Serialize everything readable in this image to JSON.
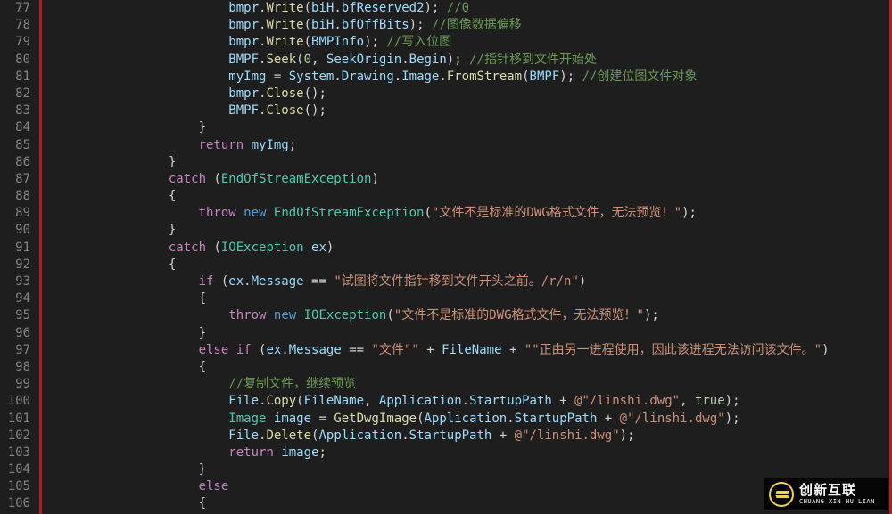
{
  "gutter": {
    "start": 77,
    "end": 106
  },
  "logo": {
    "cn": "创新互联",
    "en": "CHUANG XIN HU LIAN"
  },
  "lines": [
    [
      [
        "",
        24
      ],
      [
        "id",
        "bmpr"
      ],
      [
        "pn",
        "."
      ],
      [
        "fn",
        "Write"
      ],
      [
        "pn",
        "("
      ],
      [
        "id",
        "biH"
      ],
      [
        "pn",
        "."
      ],
      [
        "id",
        "bfReserved2"
      ],
      [
        "pn",
        "); "
      ],
      [
        "cmt",
        "//0"
      ]
    ],
    [
      [
        "",
        24
      ],
      [
        "id",
        "bmpr"
      ],
      [
        "pn",
        "."
      ],
      [
        "fn",
        "Write"
      ],
      [
        "pn",
        "("
      ],
      [
        "id",
        "biH"
      ],
      [
        "pn",
        "."
      ],
      [
        "id",
        "bfOffBits"
      ],
      [
        "pn",
        "); "
      ],
      [
        "cmt",
        "//图像数据偏移"
      ]
    ],
    [
      [
        "",
        24
      ],
      [
        "id",
        "bmpr"
      ],
      [
        "pn",
        "."
      ],
      [
        "fn",
        "Write"
      ],
      [
        "pn",
        "("
      ],
      [
        "id",
        "BMPInfo"
      ],
      [
        "pn",
        "); "
      ],
      [
        "cmt",
        "//写入位图"
      ]
    ],
    [
      [
        "",
        24
      ],
      [
        "id",
        "BMPF"
      ],
      [
        "pn",
        "."
      ],
      [
        "fn",
        "Seek"
      ],
      [
        "pn",
        "("
      ],
      [
        "num",
        "0"
      ],
      [
        "pn",
        ", "
      ],
      [
        "id",
        "SeekOrigin"
      ],
      [
        "pn",
        "."
      ],
      [
        "id",
        "Begin"
      ],
      [
        "pn",
        "); "
      ],
      [
        "cmt",
        "//指针移到文件开始处"
      ]
    ],
    [
      [
        "",
        24
      ],
      [
        "id",
        "myImg"
      ],
      [
        "pn",
        " = "
      ],
      [
        "id",
        "System"
      ],
      [
        "pn",
        "."
      ],
      [
        "id",
        "Drawing"
      ],
      [
        "pn",
        "."
      ],
      [
        "id",
        "Image"
      ],
      [
        "pn",
        "."
      ],
      [
        "fn",
        "FromStream"
      ],
      [
        "pn",
        "("
      ],
      [
        "id",
        "BMPF"
      ],
      [
        "pn",
        "); "
      ],
      [
        "cmt",
        "//创建位图文件对象"
      ]
    ],
    [
      [
        "",
        24
      ],
      [
        "id",
        "bmpr"
      ],
      [
        "pn",
        "."
      ],
      [
        "fn",
        "Close"
      ],
      [
        "pn",
        "();"
      ]
    ],
    [
      [
        "",
        24
      ],
      [
        "id",
        "BMPF"
      ],
      [
        "pn",
        "."
      ],
      [
        "fn",
        "Close"
      ],
      [
        "pn",
        "();"
      ]
    ],
    [
      [
        "",
        20
      ],
      [
        "pn",
        "}"
      ]
    ],
    [
      [
        "",
        20
      ],
      [
        "kw",
        "return"
      ],
      [
        "pn",
        " "
      ],
      [
        "id",
        "myImg"
      ],
      [
        "pn",
        ";"
      ]
    ],
    [
      [
        "",
        16
      ],
      [
        "pn",
        "}"
      ]
    ],
    [
      [
        "",
        16
      ],
      [
        "kw",
        "catch"
      ],
      [
        "pn",
        " ("
      ],
      [
        "type",
        "EndOfStreamException"
      ],
      [
        "pn",
        ")"
      ]
    ],
    [
      [
        "",
        16
      ],
      [
        "pn",
        "{"
      ]
    ],
    [
      [
        "",
        20
      ],
      [
        "kw",
        "throw"
      ],
      [
        "pn",
        " "
      ],
      [
        "blue",
        "new"
      ],
      [
        "pn",
        " "
      ],
      [
        "type",
        "EndOfStreamException"
      ],
      [
        "pn",
        "("
      ],
      [
        "str",
        "\"文件不是标准的DWG格式文件，无法预览！\""
      ],
      [
        "pn",
        ");"
      ]
    ],
    [
      [
        "",
        16
      ],
      [
        "pn",
        "}"
      ]
    ],
    [
      [
        "",
        16
      ],
      [
        "kw",
        "catch"
      ],
      [
        "pn",
        " ("
      ],
      [
        "type",
        "IOException"
      ],
      [
        "pn",
        " "
      ],
      [
        "id",
        "ex"
      ],
      [
        "pn",
        ")"
      ]
    ],
    [
      [
        "",
        16
      ],
      [
        "pn",
        "{"
      ]
    ],
    [
      [
        "",
        20
      ],
      [
        "kw",
        "if"
      ],
      [
        "pn",
        " ("
      ],
      [
        "id",
        "ex"
      ],
      [
        "pn",
        "."
      ],
      [
        "id",
        "Message"
      ],
      [
        "pn",
        " == "
      ],
      [
        "str",
        "\"试图将文件指针移到文件开头之前。/r/n\""
      ],
      [
        "pn",
        ")"
      ]
    ],
    [
      [
        "",
        20
      ],
      [
        "pn",
        "{"
      ]
    ],
    [
      [
        "",
        24
      ],
      [
        "kw",
        "throw"
      ],
      [
        "pn",
        " "
      ],
      [
        "blue",
        "new"
      ],
      [
        "pn",
        " "
      ],
      [
        "type",
        "IOException"
      ],
      [
        "pn",
        "("
      ],
      [
        "str",
        "\"文件不是标准的DWG格式文件，无法预览！\""
      ],
      [
        "pn",
        ");"
      ]
    ],
    [
      [
        "",
        20
      ],
      [
        "pn",
        "}"
      ]
    ],
    [
      [
        "",
        20
      ],
      [
        "kw",
        "else"
      ],
      [
        "pn",
        " "
      ],
      [
        "kw",
        "if"
      ],
      [
        "pn",
        " ("
      ],
      [
        "id",
        "ex"
      ],
      [
        "pn",
        "."
      ],
      [
        "id",
        "Message"
      ],
      [
        "pn",
        " == "
      ],
      [
        "str",
        "\"文件\"\""
      ],
      [
        "pn",
        " + "
      ],
      [
        "id",
        "FileName"
      ],
      [
        "pn",
        " + "
      ],
      [
        "str",
        "\"\"正由另一进程使用，因此该进程无法访问该文件。\""
      ],
      [
        "pn",
        ")"
      ]
    ],
    [
      [
        "",
        20
      ],
      [
        "pn",
        "{"
      ]
    ],
    [
      [
        "",
        24
      ],
      [
        "cmt",
        "//复制文件，继续预览"
      ]
    ],
    [
      [
        "",
        24
      ],
      [
        "id",
        "File"
      ],
      [
        "pn",
        "."
      ],
      [
        "fn",
        "Copy"
      ],
      [
        "pn",
        "("
      ],
      [
        "id",
        "FileName"
      ],
      [
        "pn",
        ", "
      ],
      [
        "id",
        "Application"
      ],
      [
        "pn",
        "."
      ],
      [
        "id",
        "StartupPath"
      ],
      [
        "pn",
        " + "
      ],
      [
        "str",
        "@\"/linshi.dwg\""
      ],
      [
        "pn",
        ", "
      ],
      [
        "num",
        "true"
      ],
      [
        "pn",
        ");"
      ]
    ],
    [
      [
        "",
        24
      ],
      [
        "type",
        "Image"
      ],
      [
        "pn",
        " "
      ],
      [
        "id",
        "image"
      ],
      [
        "pn",
        " = "
      ],
      [
        "fn",
        "GetDwgImage"
      ],
      [
        "pn",
        "("
      ],
      [
        "id",
        "Application"
      ],
      [
        "pn",
        "."
      ],
      [
        "id",
        "StartupPath"
      ],
      [
        "pn",
        " + "
      ],
      [
        "str",
        "@\"/linshi.dwg\""
      ],
      [
        "pn",
        ");"
      ]
    ],
    [
      [
        "",
        24
      ],
      [
        "id",
        "File"
      ],
      [
        "pn",
        "."
      ],
      [
        "fn",
        "Delete"
      ],
      [
        "pn",
        "("
      ],
      [
        "id",
        "Application"
      ],
      [
        "pn",
        "."
      ],
      [
        "id",
        "StartupPath"
      ],
      [
        "pn",
        " + "
      ],
      [
        "str",
        "@\"/linshi.dwg\""
      ],
      [
        "pn",
        ");"
      ]
    ],
    [
      [
        "",
        24
      ],
      [
        "kw",
        "return"
      ],
      [
        "pn",
        " "
      ],
      [
        "id",
        "image"
      ],
      [
        "pn",
        ";"
      ]
    ],
    [
      [
        "",
        20
      ],
      [
        "pn",
        "}"
      ]
    ],
    [
      [
        "",
        20
      ],
      [
        "kw",
        "else"
      ]
    ],
    [
      [
        "",
        20
      ],
      [
        "pn",
        "{"
      ]
    ]
  ]
}
